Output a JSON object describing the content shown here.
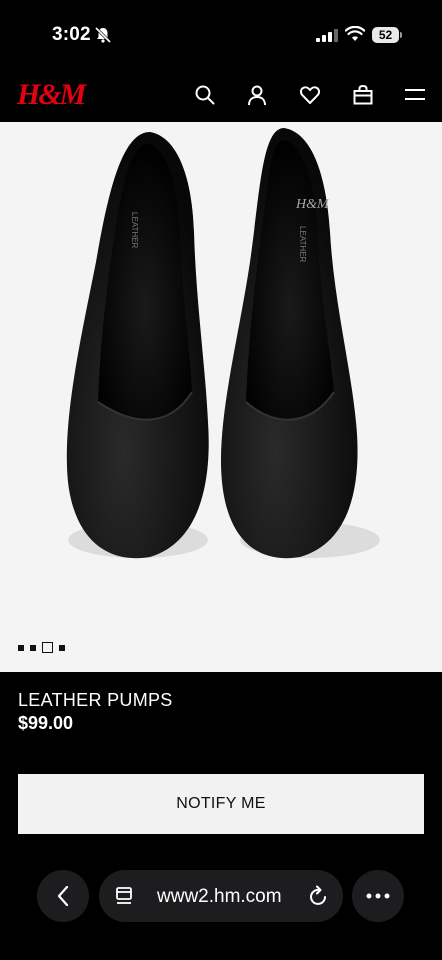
{
  "status_bar": {
    "time": "3:02",
    "battery": "52"
  },
  "header": {
    "brand": "H&M",
    "icons": [
      "search-icon",
      "account-icon",
      "heart-icon",
      "bag-icon",
      "menu-icon"
    ],
    "brand_color": "#e50010"
  },
  "gallery": {
    "image_count": 4,
    "active_index": 2
  },
  "product": {
    "name": "LEATHER PUMPS",
    "price": "$99.00"
  },
  "actions": {
    "notify_label": "NOTIFY ME"
  },
  "browser": {
    "url": "www2.hm.com"
  }
}
